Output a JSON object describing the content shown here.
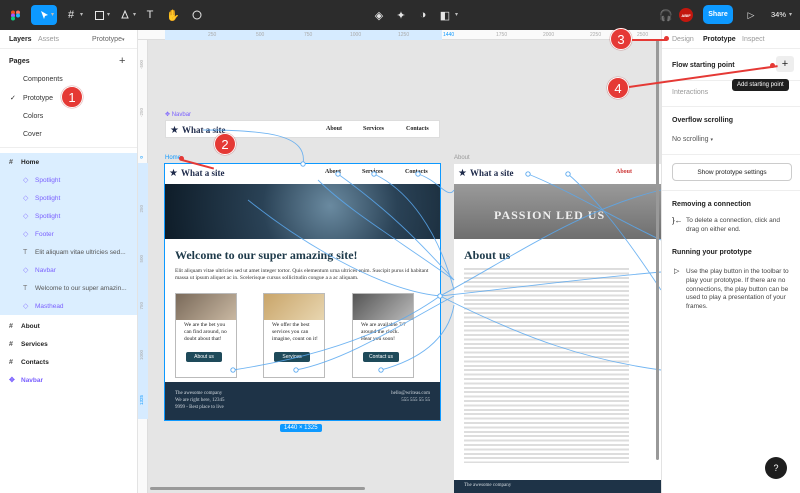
{
  "toolbar": {
    "share": "Share",
    "zoom": "34%",
    "avatar": "ABIF",
    "icons": [
      "figma-menu-icon",
      "move-tool-icon",
      "frame-tool-icon",
      "shape-tool-icon",
      "pen-tool-icon",
      "text-tool-icon",
      "hand-tool-icon",
      "comment-tool-icon",
      "component-icon",
      "mask-icon",
      "contrast-icon",
      "boolean-icon",
      "headphones-icon",
      "play-icon"
    ]
  },
  "left": {
    "tabs": {
      "layers": "Layers",
      "assets": "Assets",
      "mode": "Prototype"
    },
    "pages_title": "Pages",
    "pages": [
      "Components",
      "Prototype",
      "Colors",
      "Cover"
    ],
    "layers": [
      {
        "label": "Home",
        "kind": "frame"
      },
      {
        "label": "Spotlight",
        "kind": "component"
      },
      {
        "label": "Spotlight",
        "kind": "component"
      },
      {
        "label": "Spotlight",
        "kind": "component"
      },
      {
        "label": "Footer",
        "kind": "component"
      },
      {
        "label": "Elit aliquam vitae ultricies sed...",
        "kind": "text"
      },
      {
        "label": "Navbar",
        "kind": "component"
      },
      {
        "label": "Welcome to our super amazin...",
        "kind": "text"
      },
      {
        "label": "Masthead",
        "kind": "component"
      },
      {
        "label": "About",
        "kind": "frame"
      },
      {
        "label": "Services",
        "kind": "frame"
      },
      {
        "label": "Contacts",
        "kind": "frame"
      },
      {
        "label": "Navbar",
        "kind": "component-root"
      }
    ]
  },
  "right": {
    "tabs": {
      "design": "Design",
      "prototype": "Prototype",
      "inspect": "Inspect"
    },
    "flow_start": "Flow starting point",
    "tooltip": "Add starting point",
    "interactions": "Interactions",
    "overflow_title": "Overflow scrolling",
    "overflow_value": "No scrolling",
    "settings_button": "Show prototype settings",
    "removing_title": "Removing a connection",
    "removing_text": "To delete a connection, click and drag on either end.",
    "running_title": "Running your prototype",
    "running_text": "Use the play button in the toolbar to play your prototype. If there are no connections, the play button can be used to play a presentation of your frames.",
    "help": "?"
  },
  "ruler": {
    "top": [
      "250",
      "500",
      "750",
      "1000",
      "1250",
      "1440",
      "1750",
      "2000",
      "2250",
      "2500",
      "2750",
      "3000"
    ],
    "left": [
      "-500",
      "-250",
      "0",
      "250",
      "500",
      "750",
      "1000",
      "1325"
    ]
  },
  "canvas": {
    "navbar_component_label": "Navbar",
    "home_label": "Home",
    "about_label": "About",
    "size_badge": "1440 × 1325",
    "site_logo": "What a site",
    "nav_links": [
      "About",
      "Services",
      "Contacts"
    ],
    "hero_title": "Welcome to our super amazing site!",
    "hero_text": "Elit aliquam vitae ultricies sed ut amet integer tortor. Quis elementum urna ultrices enim. Suscipit purus id habitant massa ut ipsum aliquet ac in. Scelerisque cursus sollicitudin congue a a ac aliquam.",
    "cards": [
      {
        "text": "We are the bet you can find around, no doubt about that!",
        "button": "About us"
      },
      {
        "text": "We offer the best services you can imagine, count on it!",
        "button": "Services"
      },
      {
        "text": "We are available 7/7 around the clock. Hear you soon!",
        "button": "Contact us"
      }
    ],
    "footer_left": [
      "The awesome company",
      "We are right here, 12345",
      "9999 - Best place to live"
    ],
    "footer_right": [
      "hello@writeas.com",
      "555 555 55 55"
    ],
    "about_title": "About us",
    "about_hero_text": "PASSION LED US",
    "about_footer": "The awesome company"
  },
  "annotations": [
    "1",
    "2",
    "3",
    "4"
  ]
}
